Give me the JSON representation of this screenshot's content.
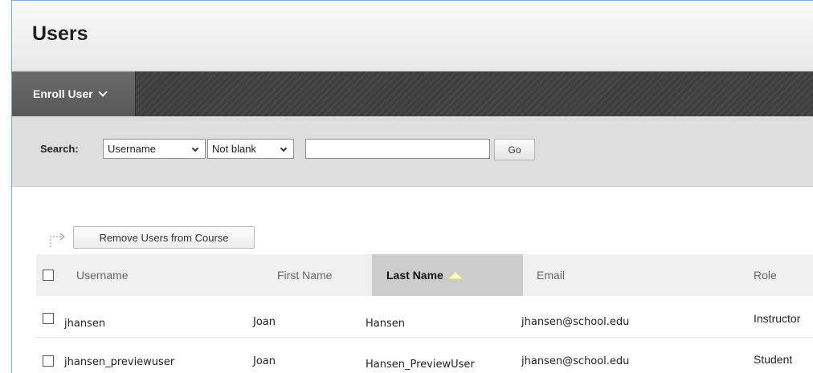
{
  "page": {
    "title": "Users"
  },
  "action_bar": {
    "enroll_label": "Enroll User"
  },
  "search": {
    "label": "Search:",
    "field_select": "Username",
    "operator_select": "Not blank",
    "query_value": "",
    "go_label": "Go"
  },
  "bulk_actions": {
    "remove_label": "Remove Users from Course"
  },
  "table": {
    "columns": [
      "Username",
      "First Name",
      "Last Name",
      "Email",
      "Role"
    ],
    "sorted_column": "Last Name",
    "sort_direction": "ascending",
    "rows": [
      {
        "username": "jhansen",
        "first_name": "Joan",
        "last_name": "Hansen",
        "email": "jhansen@school.edu",
        "role": "Instructor"
      },
      {
        "username": "jhansen_previewuser",
        "first_name": "Joan",
        "last_name": "Hansen_PreviewUser",
        "email": "jhansen@school.edu",
        "role": "Student"
      }
    ]
  },
  "colors": {
    "frame_border": "#7ea7d8",
    "action_bar": "#3e3e3e",
    "sorted_header": "#cccccc"
  }
}
